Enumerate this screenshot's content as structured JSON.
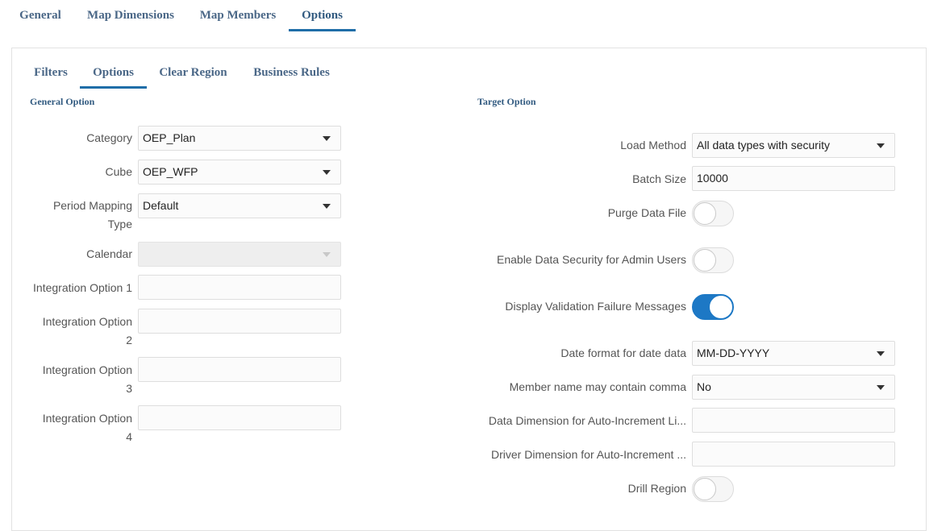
{
  "top_tabs": [
    "General",
    "Map Dimensions",
    "Map Members",
    "Options"
  ],
  "sub_tabs": [
    "Filters",
    "Options",
    "Clear Region",
    "Business Rules"
  ],
  "general_option": {
    "title": "General Option",
    "category": {
      "label": "Category",
      "value": "OEP_Plan"
    },
    "cube": {
      "label": "Cube",
      "value": "OEP_WFP"
    },
    "period_mapping": {
      "label_line1": "Period Mapping",
      "label_line2": "Type",
      "value": "Default"
    },
    "calendar": {
      "label": "Calendar",
      "value": ""
    },
    "integration_1": {
      "label": "Integration Option 1",
      "value": ""
    },
    "integration_2": {
      "label_line1": "Integration Option",
      "label_line2": "2",
      "value": ""
    },
    "integration_3": {
      "label_line1": "Integration Option",
      "label_line2": "3",
      "value": ""
    },
    "integration_4": {
      "label_line1": "Integration Option",
      "label_line2": "4",
      "value": ""
    }
  },
  "target_option": {
    "title": "Target Option",
    "load_method": {
      "label": "Load Method",
      "value": "All data types with security"
    },
    "batch_size": {
      "label": "Batch Size",
      "value": "10000"
    },
    "purge_data_file": {
      "label": "Purge Data File",
      "on": false
    },
    "enable_data_security": {
      "label": "Enable Data Security for Admin Users",
      "on": false
    },
    "display_validation": {
      "label": "Display Validation Failure Messages",
      "on": true
    },
    "date_format": {
      "label": "Date format for date data",
      "value": "MM-DD-YYYY"
    },
    "member_name_comma": {
      "label": "Member name may contain comma",
      "value": "No"
    },
    "data_dimension": {
      "label": "Data Dimension for Auto-Increment Li...",
      "value": ""
    },
    "driver_dimension": {
      "label": "Driver Dimension for Auto-Increment ...",
      "value": ""
    },
    "drill_region": {
      "label": "Drill Region",
      "on": false
    }
  },
  "colors": {
    "accent": "#1f6ea8",
    "toggle_on": "#1d78c5",
    "tab_text": "#4a6787"
  }
}
